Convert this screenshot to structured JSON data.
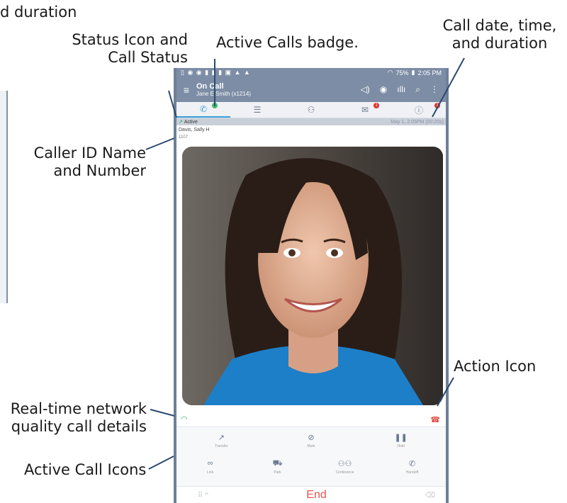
{
  "callouts": {
    "duration_partial": "d duration",
    "status_icon_line1": "Status Icon and",
    "status_icon_line2": "Call Status",
    "active_calls_badge": "Active Calls badge.",
    "call_date_line1": "Call date, time,",
    "call_date_line2": "and duration",
    "caller_id_line1": "Caller ID Name",
    "caller_id_line2": "and Number",
    "action_icon": "Action Icon",
    "network_line1": "Real-time network",
    "network_line2": "quality call details",
    "active_call_icons": "Active Call Icons"
  },
  "phone": {
    "status_bar": {
      "battery": "75%",
      "time": "2:05 PM"
    },
    "app_bar": {
      "title": "On Call",
      "subtitle": "Jane E Smith (x1214)"
    },
    "tabs": [
      {
        "icon": "phone-icon",
        "badge": "1",
        "badge_color": "#3dbb6a"
      },
      {
        "icon": "list-icon"
      },
      {
        "icon": "contact-icon"
      },
      {
        "icon": "mail-icon",
        "badge": "1",
        "badge_color": "#e0322e"
      },
      {
        "icon": "info-icon",
        "badge": "1",
        "badge_color": "#e0322e"
      }
    ],
    "call_status": {
      "status": "Active",
      "datetime": "May 1, 2:05PM (00:20s)"
    },
    "caller": {
      "name": "Davis, Sally H",
      "number": "1107"
    },
    "call_icons": [
      {
        "label": "Transfer",
        "icon": "transfer-icon"
      },
      {
        "label": "Mute",
        "icon": "mute-icon"
      },
      {
        "label": "Hold",
        "icon": "hold-icon"
      },
      {
        "label": "Link",
        "icon": "link-icon"
      },
      {
        "label": "Park",
        "icon": "park-icon"
      },
      {
        "label": "Conference",
        "icon": "conference-icon"
      },
      {
        "label": "Handoff",
        "icon": "handoff-icon"
      }
    ],
    "end_label": "End"
  },
  "colors": {
    "app_bar": "#7d8da5",
    "active_tab": "#3ba0d8",
    "end": "#e8554c",
    "network_icon": "#2bb56a"
  }
}
